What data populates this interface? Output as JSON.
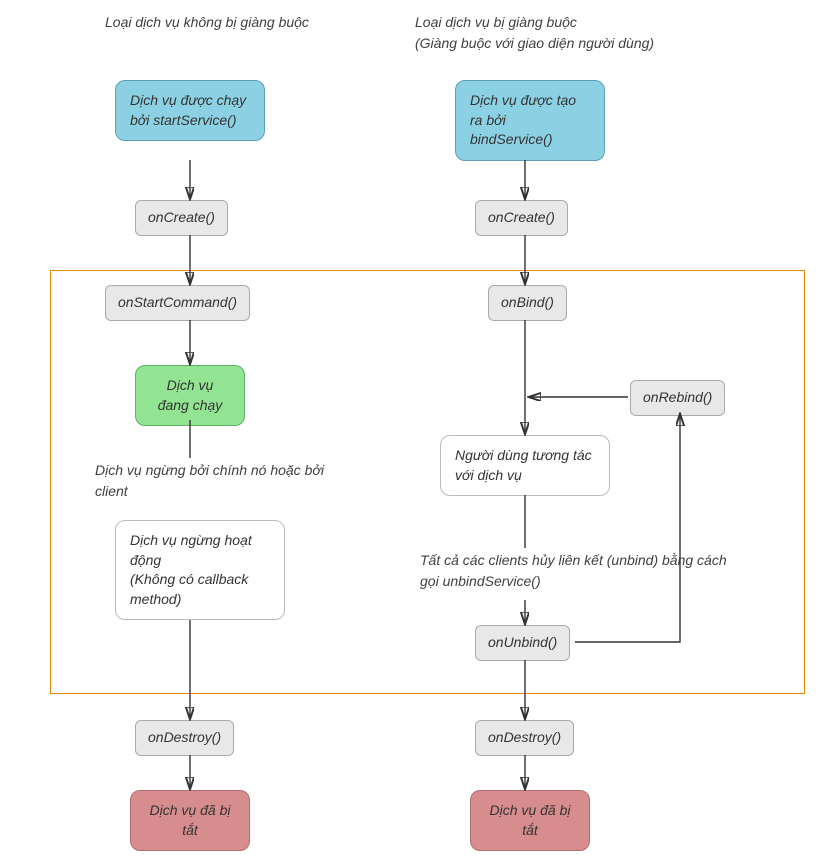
{
  "left": {
    "header": "Loại dịch vụ không bị giàng buộc",
    "start": "Dịch vụ được chạy bởi startService()",
    "onCreate": "onCreate()",
    "onStartCommand": "onStartCommand()",
    "running": "Dịch vụ đang chạy",
    "stopNote": "Dịch vụ ngừng bởi chính nó hoặc bởi client",
    "stopBox": "Dịch vụ ngừng hoạt động\n(Không có callback method)",
    "onDestroy": "onDestroy()",
    "shutdown": "Dịch vụ đã bị tắt"
  },
  "right": {
    "header": "Loại dịch vụ bị giàng buộc\n(Giàng buộc với giao diện người dùng)",
    "start": "Dịch vụ được tạo ra bởi bindService()",
    "onCreate": "onCreate()",
    "onBind": "onBind()",
    "onRebind": "onRebind()",
    "interact": "Người dùng tương tác với dịch vụ",
    "unbindNote": "Tất cả các clients hủy liên kết (unbind) bằng cách gọi unbindService()",
    "onUnbind": "onUnbind()",
    "onDestroy": "onDestroy()",
    "shutdown": "Dịch vụ đã bị tắt"
  },
  "colors": {
    "blue": "#8bd1e3",
    "grey": "#e8e8e8",
    "green": "#92e492",
    "red": "#d78c8e",
    "activeBorder": "#e08a00"
  }
}
